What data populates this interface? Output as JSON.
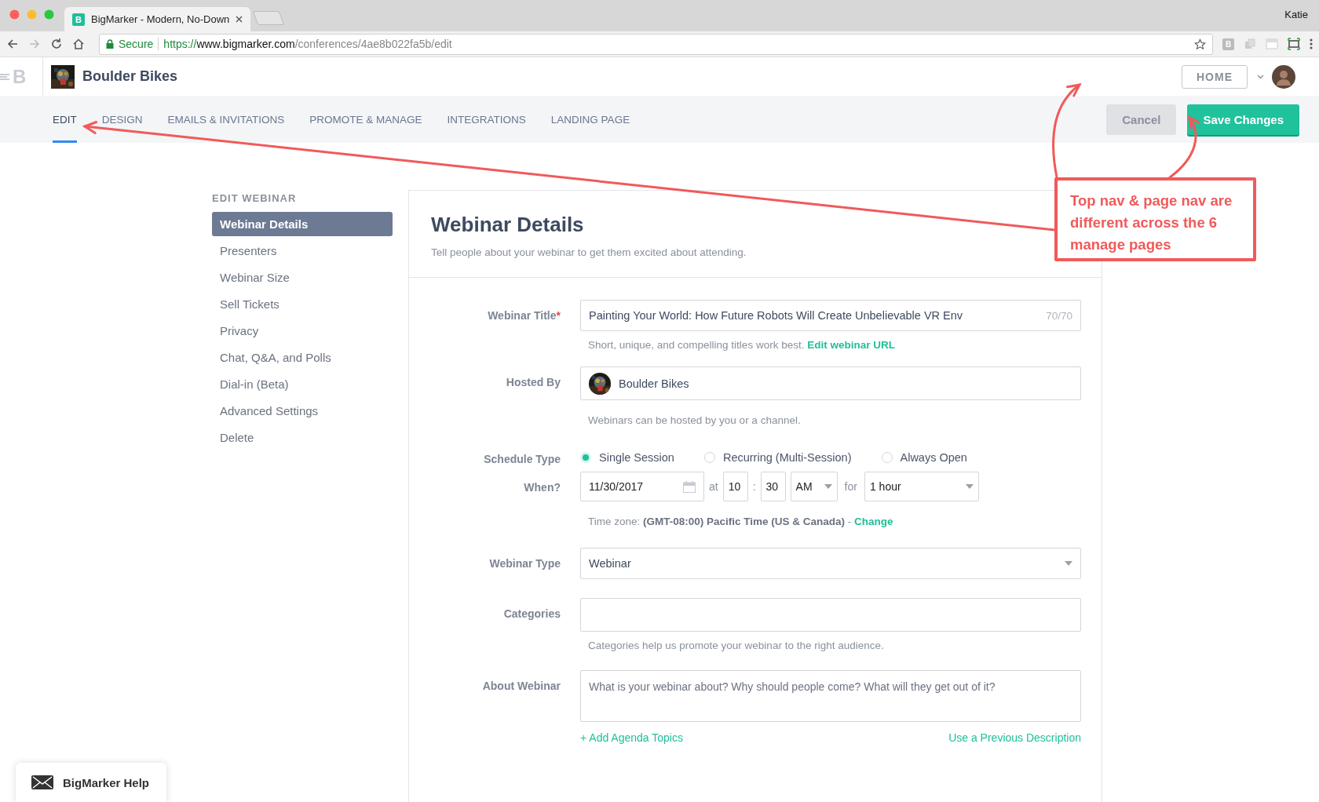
{
  "browser": {
    "favicon": "B",
    "tab_title": "BigMarker - Modern, No-Down",
    "profile": "Katie",
    "secure": "Secure",
    "scheme": "https://",
    "host": "www.bigmarker.com",
    "path": "/conferences/4ae8b022fa5b/edit",
    "extension": "B"
  },
  "header": {
    "app_logo": "B",
    "brand": "Boulder Bikes",
    "home_button": "HOME"
  },
  "tabs": [
    {
      "label": "EDIT",
      "selected": true
    },
    {
      "label": "DESIGN",
      "selected": false
    },
    {
      "label": "EMAILS & INVITATIONS",
      "selected": false
    },
    {
      "label": "PROMOTE & MANAGE",
      "selected": false
    },
    {
      "label": "INTEGRATIONS",
      "selected": false
    },
    {
      "label": "LANDING PAGE",
      "selected": false
    }
  ],
  "actions": {
    "cancel": "Cancel",
    "save": "Save Changes"
  },
  "sidebar": {
    "heading": "EDIT WEBINAR",
    "items": [
      {
        "label": "Webinar Details",
        "selected": true
      },
      {
        "label": "Presenters",
        "selected": false
      },
      {
        "label": "Webinar Size",
        "selected": false
      },
      {
        "label": "Sell Tickets",
        "selected": false
      },
      {
        "label": "Privacy",
        "selected": false
      },
      {
        "label": "Chat, Q&A, and Polls",
        "selected": false
      },
      {
        "label": "Dial-in (Beta)",
        "selected": false
      },
      {
        "label": "Advanced Settings",
        "selected": false
      },
      {
        "label": "Delete",
        "selected": false
      }
    ]
  },
  "form": {
    "title": "Webinar Details",
    "subtitle": "Tell people about your webinar to get them excited about attending.",
    "webinar_title": {
      "label": "Webinar Title",
      "required_mark": "*",
      "value": "Painting Your World: How Future Robots Will Create Unbelievable VR Env",
      "counter": "70/70",
      "hint": "Short, unique, and compelling titles work best.",
      "link": "Edit webinar URL"
    },
    "hosted_by": {
      "label": "Hosted By",
      "value": "Boulder Bikes",
      "hint": "Webinars can be hosted by you or a channel."
    },
    "schedule_type": {
      "label": "Schedule Type",
      "options": [
        {
          "label": "Single Session",
          "selected": true
        },
        {
          "label": "Recurring (Multi-Session)",
          "selected": false
        },
        {
          "label": "Always Open",
          "selected": false
        }
      ]
    },
    "when": {
      "label": "When?",
      "date": "11/30/2017",
      "at": "at",
      "hour": "10",
      "separator": ":",
      "minute": "30",
      "meridiem": "AM",
      "for": "for",
      "duration": "1 hour",
      "timezone": "Time zone: **(GMT-08:00) Pacific Time (US & Canada)** - ",
      "change_link": "Change"
    },
    "webinar_type": {
      "label": "Webinar Type",
      "value": "Webinar"
    },
    "categories": {
      "label": "Categories",
      "hint": "Categories help us promote your webinar to the right audience."
    },
    "about": {
      "label": "About Webinar",
      "placeholder": "What is your webinar about? Why should people come? What will they get out of it?",
      "add_link": "+ Add Agenda Topics",
      "previous_link": "Use a Previous Description"
    }
  },
  "help": {
    "label": "BigMarker Help"
  },
  "annotation": {
    "text": "Top nav & page nav are different across the 6 manage pages"
  }
}
